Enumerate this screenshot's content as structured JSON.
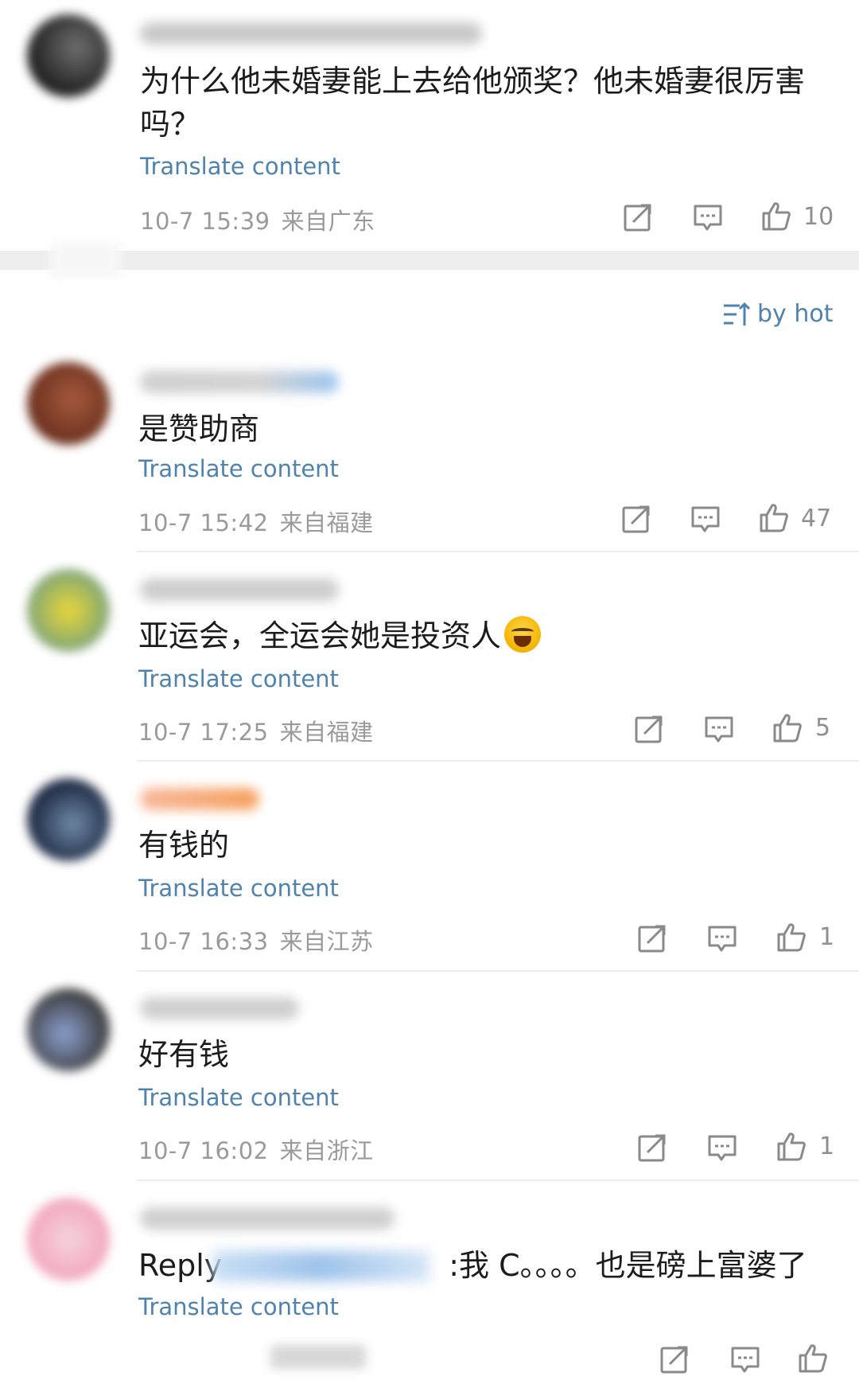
{
  "post": {
    "text_line1": "为什么他未婚妻能上去给他颁奖？他未婚妻很厉害",
    "text_line2": "吗？",
    "translate": "Translate content",
    "time": "10-7 15:39",
    "location": "来自广东",
    "likes": "10"
  },
  "sort_label": "by hot",
  "comments": [
    {
      "text": "是赞助商",
      "translate": "Translate content",
      "time": "10-7 15:42",
      "location": "来自福建",
      "likes": "47"
    },
    {
      "text": "亚运会，全运会她是投资人",
      "translate": "Translate content",
      "time": "10-7 17:25",
      "location": "来自福建",
      "likes": "5"
    },
    {
      "text": "有钱的",
      "translate": "Translate content",
      "time": "10-7 16:33",
      "location": "来自江苏",
      "likes": "1"
    },
    {
      "text": "好有钱",
      "translate": "Translate content",
      "time": "10-7 16:02",
      "location": "来自浙江",
      "likes": "1"
    },
    {
      "text_prefix": "Reply",
      "text_suffix": ":我 C。。。。也是磅上富婆了",
      "translate": "Translate content"
    }
  ],
  "icons": [
    "share-icon",
    "comment-icon",
    "thumbs-up-icon",
    "sort-icon",
    "crying-laughing-emoji-icon"
  ],
  "colors": {
    "link": "#4f83ad",
    "meta": "#9a9a9a",
    "divider": "#ededed",
    "gap": "#eeeeee"
  }
}
